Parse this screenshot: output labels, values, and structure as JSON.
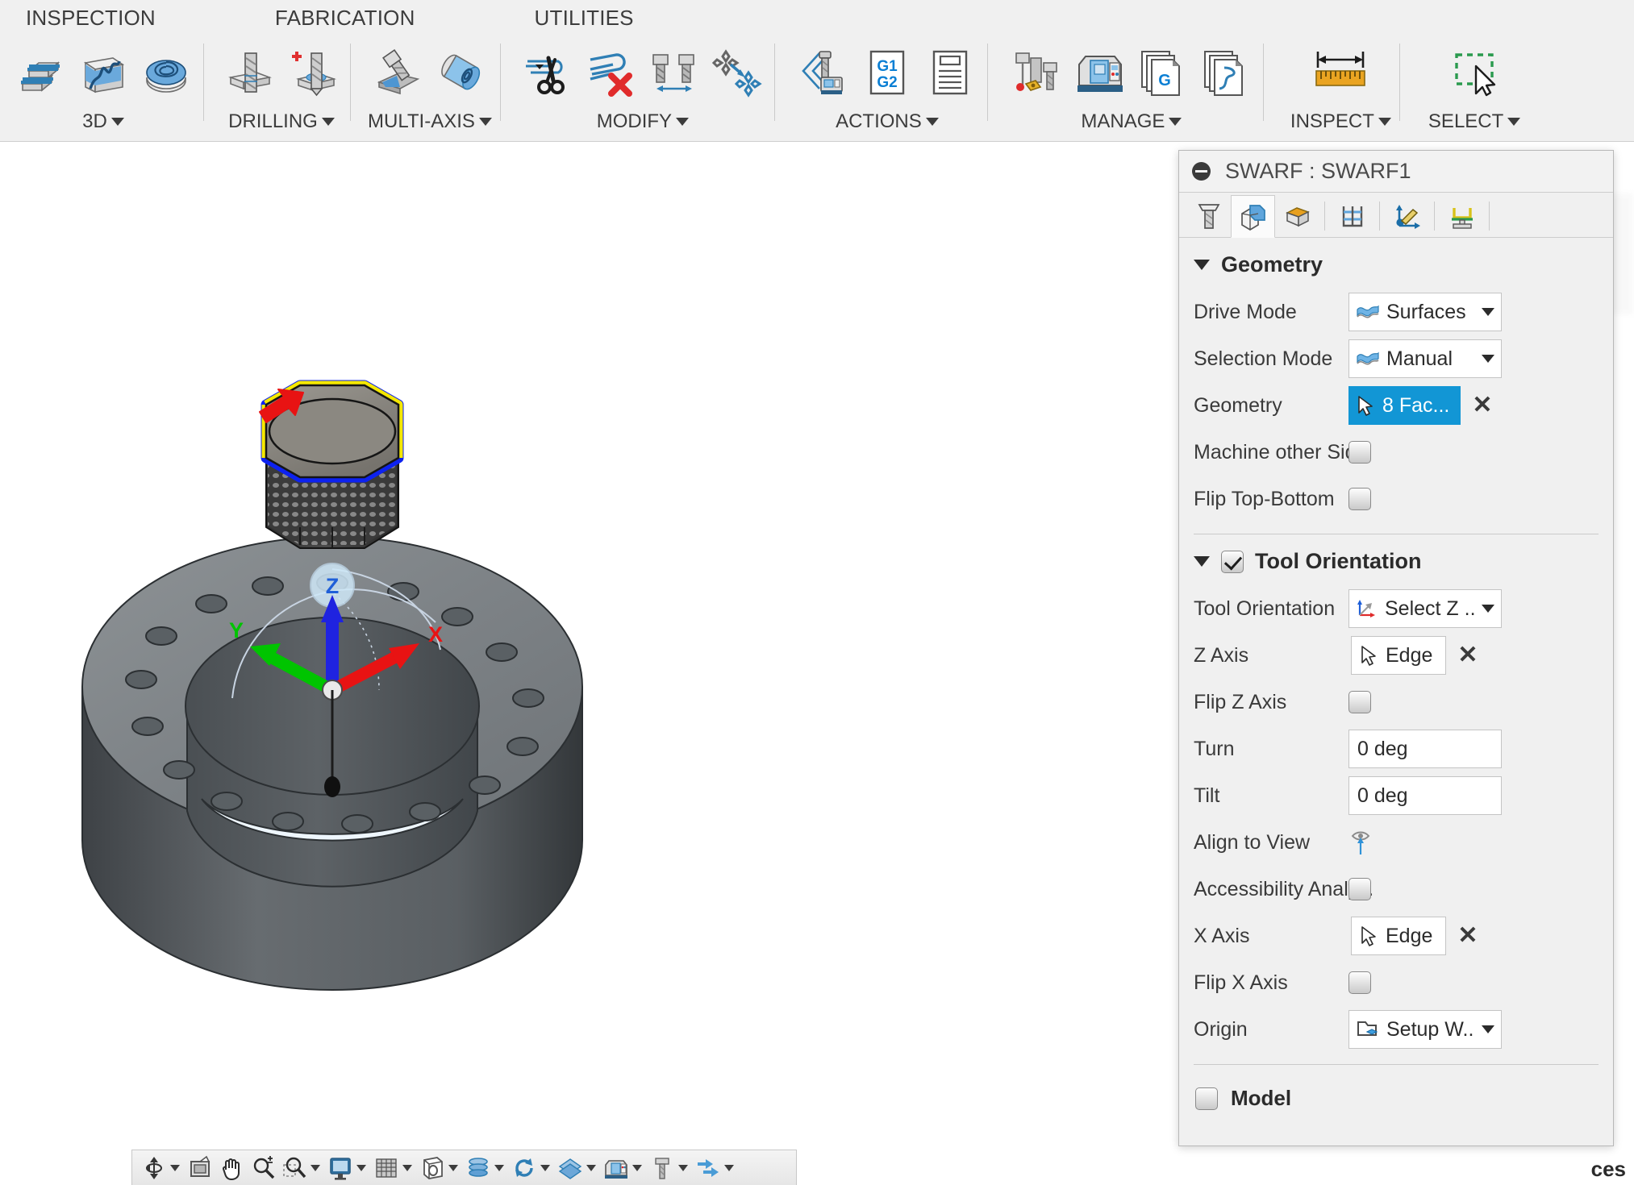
{
  "app": {
    "ribbon_tabs": [
      {
        "label": "INSPECTION",
        "name": "tab-inspection"
      },
      {
        "label": "FABRICATION",
        "name": "tab-fabrication"
      },
      {
        "label": "UTILITIES",
        "name": "tab-utilities"
      }
    ],
    "ribbon_groups": [
      {
        "label": "3D",
        "has_caret": true,
        "buttons": [
          {
            "icon": "parallel-3d-icon",
            "tip": "Parallel"
          },
          {
            "icon": "scallop-3d-icon",
            "tip": "Scallop"
          },
          {
            "icon": "morphed-spiral-icon",
            "tip": "Morphed Spiral"
          }
        ]
      },
      {
        "label": "DRILLING",
        "has_caret": true,
        "buttons": [
          {
            "icon": "drill-icon",
            "tip": "Drill"
          },
          {
            "icon": "drill-add-icon",
            "tip": "Bore"
          }
        ]
      },
      {
        "label": "MULTI-AXIS",
        "has_caret": true,
        "buttons": [
          {
            "icon": "swarf-icon",
            "tip": "Swarf"
          },
          {
            "icon": "multi-axis-contour-icon",
            "tip": "Multi-Axis Contour"
          }
        ]
      },
      {
        "label": "MODIFY",
        "has_caret": true,
        "buttons": [
          {
            "icon": "trim-toolpath-icon",
            "tip": "Trim Toolpath"
          },
          {
            "icon": "delete-toolpath-icon",
            "tip": "Delete Toolpath"
          },
          {
            "icon": "tool-change-icon",
            "tip": "Tool Change"
          },
          {
            "icon": "transform-icon",
            "tip": "Transform"
          }
        ]
      },
      {
        "label": "ACTIONS",
        "has_caret": true,
        "buttons": [
          {
            "icon": "post-process-icon",
            "tip": "Post Process"
          },
          {
            "icon": "g1-g2-icon",
            "tip": "NC Program"
          },
          {
            "icon": "setup-sheet-icon",
            "tip": "Setup Sheet"
          }
        ]
      },
      {
        "label": "MANAGE",
        "has_caret": true,
        "buttons": [
          {
            "icon": "tool-library-icon",
            "tip": "Tool Library"
          },
          {
            "icon": "machine-library-icon",
            "tip": "Machine Library"
          },
          {
            "icon": "post-library-icon",
            "tip": "Post Library"
          },
          {
            "icon": "template-library-icon",
            "tip": "Template Library"
          }
        ]
      },
      {
        "label": "INSPECT",
        "has_caret": true,
        "buttons": [
          {
            "icon": "measure-ruler-icon",
            "tip": "Measure"
          }
        ]
      },
      {
        "label": "SELECT",
        "has_caret": true,
        "buttons": [
          {
            "icon": "select-marquee-icon",
            "tip": "Select"
          }
        ]
      }
    ],
    "navbar": [
      {
        "icon": "orbit-icon",
        "caret": true
      },
      {
        "icon": "look-at-icon",
        "caret": false
      },
      {
        "icon": "pan-hand-icon",
        "caret": false
      },
      {
        "icon": "zoom-icon",
        "caret": false
      },
      {
        "icon": "zoom-window-icon",
        "caret": true
      },
      {
        "icon": "display-settings-icon",
        "caret": true
      },
      {
        "icon": "grid-snap-icon",
        "caret": true
      },
      {
        "icon": "viewports-icon",
        "caret": true
      },
      {
        "icon": "layers-stack-icon",
        "caret": true
      },
      {
        "icon": "refresh-icon",
        "caret": true
      },
      {
        "icon": "visual-style-icon",
        "caret": true
      },
      {
        "icon": "machine-sim-icon",
        "caret": true
      },
      {
        "icon": "tool-view-icon",
        "caret": true
      },
      {
        "icon": "stock-sim-icon",
        "caret": true
      }
    ]
  },
  "panel": {
    "title": "SWARF : SWARF1",
    "collapse_icon": "minus-circle-icon",
    "tabs": [
      {
        "name": "tab-tool",
        "icon": "tool-tab-icon",
        "active": false
      },
      {
        "name": "tab-geometry",
        "icon": "geometry-tab-icon",
        "active": true
      },
      {
        "name": "tab-heights",
        "icon": "heights-tab-icon",
        "active": false
      },
      {
        "name": "tab-passes",
        "icon": "passes-tab-icon",
        "active": false
      },
      {
        "name": "tab-linking",
        "icon": "linking-tab-icon",
        "active": false
      },
      {
        "name": "tab-manual-nc",
        "icon": "manual-nc-tab-icon",
        "active": false
      }
    ],
    "geometry_section": {
      "title": "Geometry",
      "expanded": true,
      "rows": [
        {
          "label": "Drive Mode",
          "type": "combo",
          "value": "Surfaces",
          "icon": "surfaces-icon"
        },
        {
          "label": "Selection Mode",
          "type": "combo",
          "value": "Manual",
          "icon": "surfaces-icon"
        },
        {
          "label": "Geometry",
          "type": "selected",
          "value": "8 Fac...",
          "icon": "cursor-arrow-icon",
          "clear": "✕"
        },
        {
          "label": "Machine other Side",
          "type": "checkbox",
          "checked": false
        },
        {
          "label": "Flip Top-Bottom",
          "type": "checkbox",
          "checked": false
        }
      ]
    },
    "tool_orientation_section": {
      "title": "Tool Orientation",
      "expanded": true,
      "checked": true,
      "rows": [
        {
          "label": "Tool Orientation",
          "type": "combo",
          "value": "Select Z ...",
          "icon": "axis-triad-icon"
        },
        {
          "label": "Z Axis",
          "type": "select",
          "value": "Edge",
          "icon": "cursor-arrow-icon",
          "clear": "✕"
        },
        {
          "label": "Flip Z Axis",
          "type": "checkbox",
          "checked": false
        },
        {
          "label": "Turn",
          "type": "text",
          "value": "0 deg"
        },
        {
          "label": "Tilt",
          "type": "text",
          "value": "0 deg"
        },
        {
          "label": "Align to View",
          "type": "action",
          "icon": "eye-align-icon"
        },
        {
          "label": "Accessibility Analy...",
          "type": "checkbox",
          "checked": false
        },
        {
          "label": "X Axis",
          "type": "select",
          "value": "Edge",
          "icon": "cursor-arrow-icon",
          "clear": "✕"
        },
        {
          "label": "Flip X Axis",
          "type": "checkbox",
          "checked": false
        },
        {
          "label": "Origin",
          "type": "combo",
          "value": "Setup W...",
          "icon": "origin-wcs-icon"
        }
      ]
    },
    "model_section": {
      "label": "Model",
      "checked": false
    }
  },
  "viewport": {
    "partial_text": "ces",
    "axes": [
      {
        "name": "x-axis-label",
        "label": "X",
        "color": "#e81313"
      },
      {
        "name": "y-axis-label",
        "label": "Y",
        "color": "#00c400"
      },
      {
        "name": "z-axis-label",
        "label": "Z",
        "color": "#1f5fd8"
      }
    ],
    "selected_face_highlight": "#f5e800",
    "secondary_highlight": "#0d22f0",
    "direction_arrow_color": "#e81313"
  },
  "colors": {
    "accent_blue": "#1296d5",
    "ribbon_bg": "#f0f0f0",
    "panel_bg": "#f0f0f0",
    "icon_blue": "#2f7fb5",
    "text": "#3a3a3a"
  }
}
